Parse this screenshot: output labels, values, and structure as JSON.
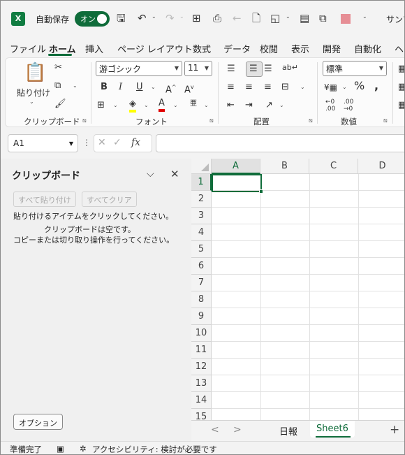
{
  "title_bar": {
    "app_letter": "X",
    "autosave_label": "自動保存",
    "autosave_state": "オン",
    "user_name_partial": "サンブ"
  },
  "tabs": [
    {
      "label": "ファイル"
    },
    {
      "label": "ホーム"
    },
    {
      "label": "挿入"
    },
    {
      "label": "ページ レイアウト"
    },
    {
      "label": "数式"
    },
    {
      "label": "データ"
    },
    {
      "label": "校閲"
    },
    {
      "label": "表示"
    },
    {
      "label": "開発"
    },
    {
      "label": "自動化"
    },
    {
      "label": "ヘ"
    }
  ],
  "ribbon": {
    "clipboard": {
      "paste_label": "貼り付け",
      "group_label": "クリップボード"
    },
    "font": {
      "font_name": "游ゴシック",
      "font_size": "11",
      "group_label": "フォント"
    },
    "alignment": {
      "group_label": "配置"
    },
    "number": {
      "format": "標準",
      "group_label": "数値"
    }
  },
  "formula_bar": {
    "name_box": "A1",
    "fx": "fx",
    "formula": ""
  },
  "clipboard_pane": {
    "title": "クリップボード",
    "paste_all": "すべて貼り付け",
    "clear_all": "すべてクリア",
    "instruction": "貼り付けるアイテムをクリックしてください。",
    "empty_line1": "クリップボードは空です。",
    "empty_line2": "コピーまたは切り取り操作を行ってください。",
    "options": "オプション"
  },
  "grid": {
    "columns": [
      "A",
      "B",
      "C",
      "D"
    ],
    "rows": [
      "1",
      "2",
      "3",
      "4",
      "5",
      "6",
      "7",
      "8",
      "9",
      "10",
      "11",
      "12",
      "13",
      "14",
      "15"
    ],
    "active_cell": "A1"
  },
  "sheets": {
    "tabs": [
      "日報",
      "Sheet6"
    ],
    "active": "Sheet6"
  },
  "status_bar": {
    "ready": "準備完了",
    "accessibility": "アクセシビリティ: 検討が必要です"
  },
  "colors": {
    "accent": "#0f6c3a",
    "brand": "#107c41"
  }
}
